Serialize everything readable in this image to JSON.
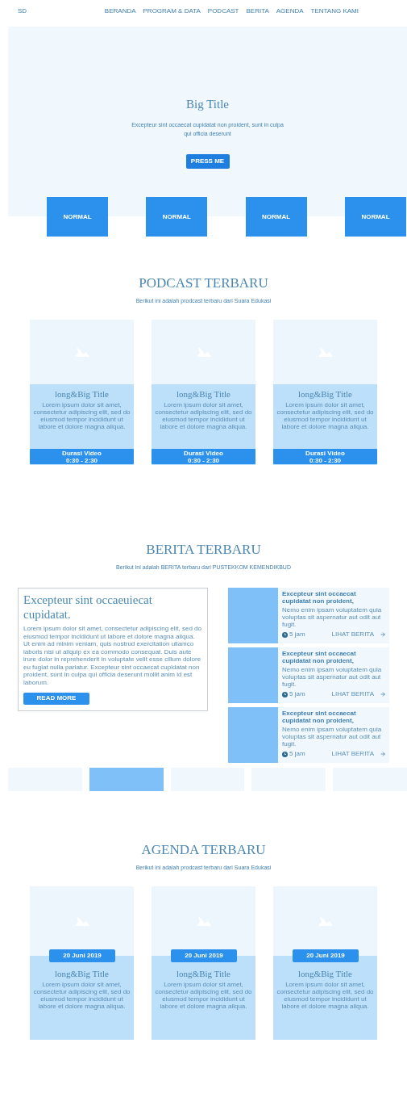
{
  "nav": {
    "logo": "SD",
    "items": [
      {
        "label": "BERANDA",
        "selected": false
      },
      {
        "label": "PROGRAM & DATA",
        "selected": false
      },
      {
        "label": "PODCAST",
        "selected": false
      },
      {
        "label": "BERITA",
        "selected": false
      },
      {
        "label": "AGENDA",
        "selected": false
      },
      {
        "label": "TENTANG KAMI",
        "selected": false
      }
    ]
  },
  "hero": {
    "title": "Big Title",
    "subtitle": "Excepteur sint occaecat cupidatat non proident, sunt in culpa qui officia deserunt",
    "button": "PRESS ME",
    "tiles": [
      "NORMAL",
      "NORMAL",
      "NORMAL",
      "NORMAL"
    ]
  },
  "podcast": {
    "title": "PODCAST TERBARU",
    "subtitle": "Berikut ini adalah prodcast terbaru dari Suara Edukasi",
    "cards": [
      {
        "title": "long&Big Title",
        "text": "Lorem ipsum dolor sit amet, consectetur adipiscing elit, sed do eiusmod tempor incididunt ut labore et dolore magna aliqua.",
        "button_line1": "Durasi Video",
        "button_line2": "0:30 - 2:30"
      },
      {
        "title": "long&Big Title",
        "text": "Lorem ipsum dolor sit amet, consectetur adipiscing elit, sed do eiusmod tempor incididunt ut labore et dolore magna aliqua.",
        "button_line1": "Durasi Video",
        "button_line2": "0:30 - 2:30"
      },
      {
        "title": "long&Big Title",
        "text": "Lorem ipsum dolor sit amet, consectetur adipiscing elit, sed do eiusmod tempor incididunt ut labore et dolore magna aliqua.",
        "button_line1": "Durasi Video",
        "button_line2": "0:30 - 2:30"
      }
    ]
  },
  "berita": {
    "title": "BERITA TERBARU",
    "subtitle": "Berikut ini adalah BERITA terbaru dari PUSTEKKOM KEMENDIKBUD",
    "featured": {
      "title": "Excepteur sint occaeuiecat cupidatat.",
      "text": "Lorem ipsum dolor sit amet, consectetur adipiscing elit, sed do eiusmod tempor incididunt ut labore et dolore magna aliqua. Ut enim ad minim veniam, quis nostrud exercitation ullamco laboris nisi ut aliquip ex ea commodo consequat. Duis aute irure dolor in reprehenderit in voluptate velit esse cillum dolore eu fugiat nulla pariatur. Excepteur sint occaecat cupidatat non proident, sunt in culpa qui officia deserunt mollit anim id est laborum.",
      "button": "READ MORE"
    },
    "items": [
      {
        "title": "Excepteur sint occaecat cupidatat non proident,",
        "text": "Nemo enim ipsam voluptatem quia voluptas sit aspernatur aut odit aut fugit.",
        "time": "5 jam",
        "link": "LIHAT BERITA"
      },
      {
        "title": "Excepteur sint occaecat cupidatat non proident,",
        "text": "Nemo enim ipsam voluptatem quia voluptas sit aspernatur aut odit aut fugit.",
        "time": "5 jam",
        "link": "LIHAT BERITA"
      },
      {
        "title": "Excepteur sint occaecat cupidatat non proident,",
        "text": "Nemo enim ipsam voluptatem quia voluptas sit aspernatur aut odit aut fugit.",
        "time": "5 jam",
        "link": "LIHAT BERITA"
      }
    ],
    "strip": [
      {
        "selected": false
      },
      {
        "selected": true
      },
      {
        "selected": false
      },
      {
        "selected": false
      },
      {
        "selected": false
      }
    ]
  },
  "agenda": {
    "title": "AGENDA TERBARU",
    "subtitle": "Berikut ini adalah prodcast terbaru dari Suara Edukasi",
    "cards": [
      {
        "date": "20 Juni 2019",
        "title": "long&Big Title",
        "text": "Lorem ipsum dolor sit amet, consectetur adipiscing elit, sed do eiusmod tempor incididunt ut labore et dolore magna aliqua."
      },
      {
        "date": "20 Juni 2019",
        "title": "long&Big Title",
        "text": "Lorem ipsum dolor sit amet, consectetur adipiscing elit, sed do eiusmod tempor incididunt ut labore et dolore magna aliqua."
      },
      {
        "date": "20 Juni 2019",
        "title": "long&Big Title",
        "text": "Lorem ipsum dolor sit amet, consectetur adipiscing elit, sed do eiusmod tempor incididunt ut labore et dolore magna aliqua."
      }
    ]
  }
}
